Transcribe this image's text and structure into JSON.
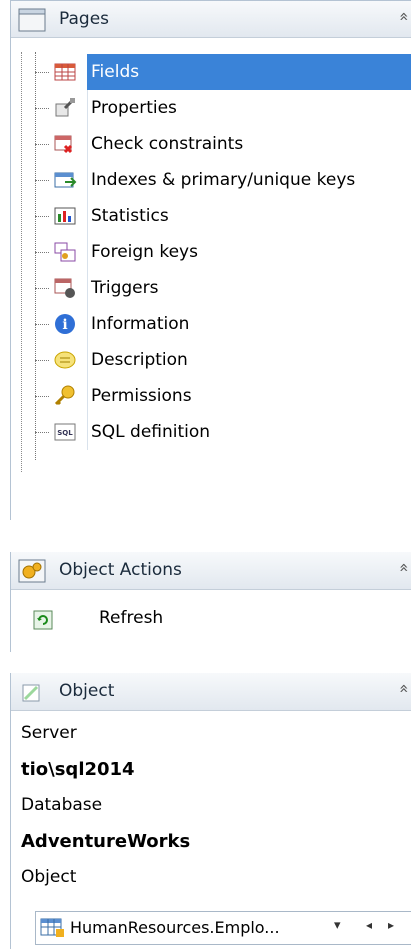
{
  "pages_panel": {
    "title": "Pages",
    "collapse_glyph": "»",
    "items": [
      {
        "label": "Fields",
        "icon": "fields-icon",
        "selected": true
      },
      {
        "label": "Properties",
        "icon": "properties-icon",
        "selected": false
      },
      {
        "label": "Check constraints",
        "icon": "check-constraints-icon",
        "selected": false
      },
      {
        "label": "Indexes & primary/unique keys",
        "icon": "indexes-icon",
        "selected": false
      },
      {
        "label": "Statistics",
        "icon": "statistics-icon",
        "selected": false
      },
      {
        "label": "Foreign keys",
        "icon": "foreign-keys-icon",
        "selected": false
      },
      {
        "label": "Triggers",
        "icon": "triggers-icon",
        "selected": false
      },
      {
        "label": "Information",
        "icon": "information-icon",
        "selected": false
      },
      {
        "label": "Description",
        "icon": "description-icon",
        "selected": false
      },
      {
        "label": "Permissions",
        "icon": "permissions-icon",
        "selected": false
      },
      {
        "label": "SQL definition",
        "icon": "sql-definition-icon",
        "selected": false
      }
    ]
  },
  "actions_panel": {
    "title": "Object Actions",
    "collapse_glyph": "»",
    "refresh_label": "Refresh"
  },
  "object_panel": {
    "title": "Object",
    "collapse_glyph": "»",
    "server_label": "Server",
    "server_value": "tio\\sql2014",
    "database_label": "Database",
    "database_value": "AdventureWorks",
    "object_label": "Object",
    "object_value": "HumanResources.Emplo...",
    "dropdown_glyph": "▾",
    "prev_glyph": "◂",
    "next_glyph": "▸"
  },
  "colors": {
    "selected_bg": "#3a83d8",
    "header_bg": "#e2e8ef"
  }
}
